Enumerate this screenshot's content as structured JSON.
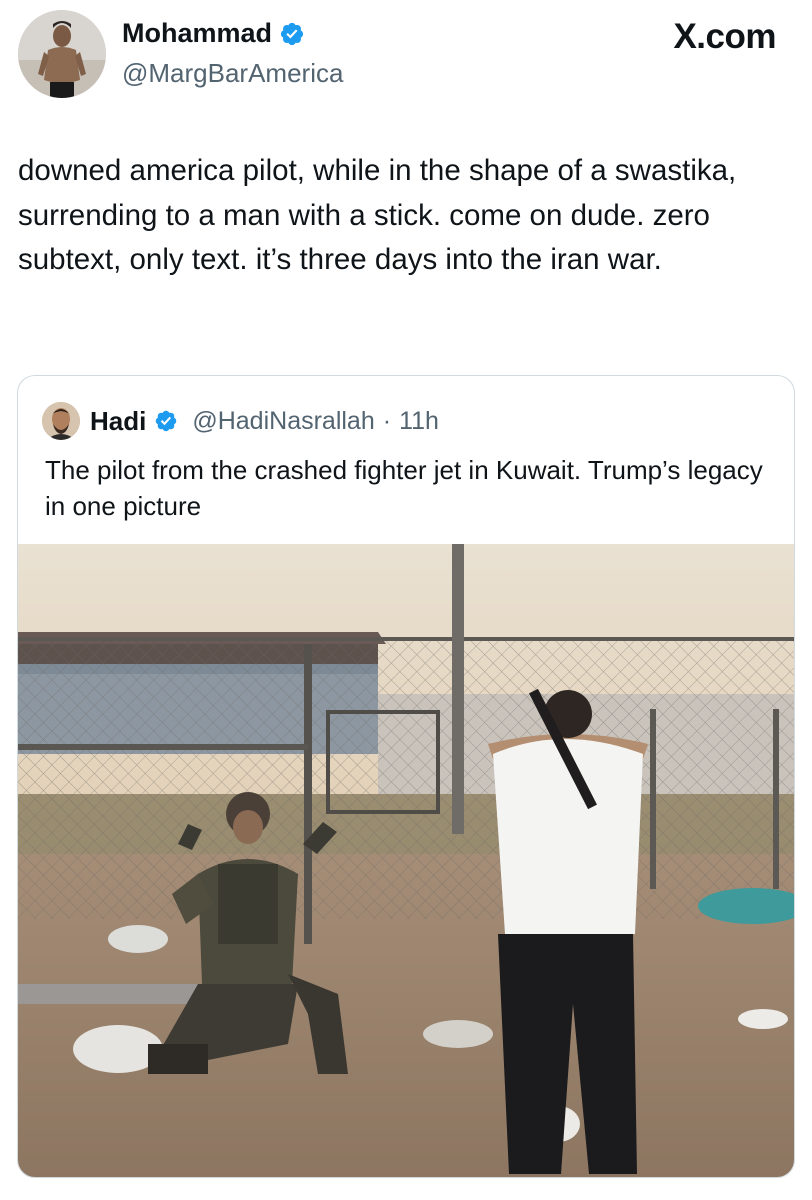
{
  "tweet": {
    "author": {
      "name": "Mohammad",
      "handle": "@MargBarAmerica",
      "verified": true,
      "avatar_icon": "profile-photo"
    },
    "brand": "X.com",
    "text": "downed america pilot, while in the shape of a swastika, surrending to a man with a stick. come on dude. zero subtext, only text. it’s three days into the iran war."
  },
  "quoted_tweet": {
    "author": {
      "name": "Hadi",
      "handle": "@HadiNasrallah",
      "verified": true,
      "avatar_icon": "profile-photo"
    },
    "separator": "·",
    "time": "11h",
    "text": "The pilot from the crashed fighter jet in Kuwait. Trump’s legacy in one picture",
    "media": {
      "kind": "photo"
    }
  },
  "colors": {
    "verified_blue": "#1d9bf0",
    "secondary_text": "#536471",
    "border": "#cfd9de",
    "primary_text": "#0f1419"
  }
}
